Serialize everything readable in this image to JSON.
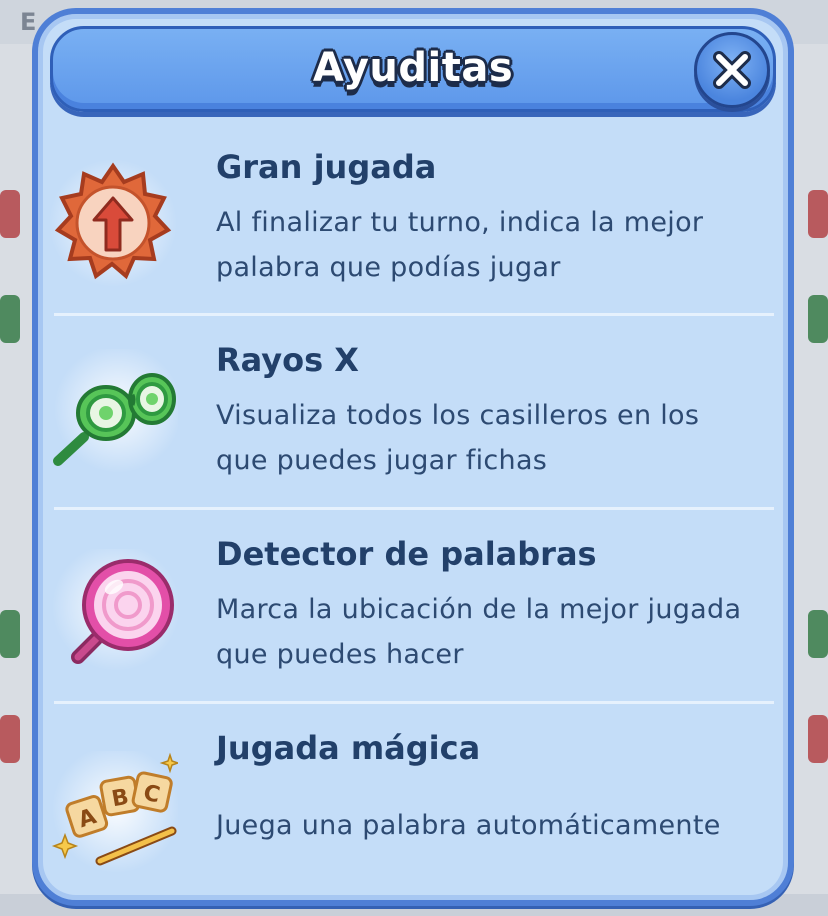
{
  "background": {
    "title_fragment": "E"
  },
  "dialog": {
    "title": "Ayuditas",
    "close_label": "close"
  },
  "helpers": [
    {
      "name": "Gran jugada",
      "description_line1": "Al finalizar tu turno, indica la mejor",
      "description_line2": "palabra que podías jugar",
      "icon": "arrow-badge-icon"
    },
    {
      "name": "Rayos X",
      "description_line1": "Visualiza todos los casilleros en los",
      "description_line2": "que puedes jugar fichas",
      "icon": "xray-glasses-icon"
    },
    {
      "name": "Detector de palabras",
      "description_line1": "Marca la ubicación de la mejor jugada",
      "description_line2": "que puedes hacer",
      "icon": "magnifier-icon"
    },
    {
      "name": "Jugada mágica",
      "description_line1": "Juega una palabra automáticamente",
      "icon": "magic-letters-icon"
    }
  ],
  "colors": {
    "panel": "#c4ddf8",
    "header": "#6aa3ef",
    "text": "#22406a",
    "border": "#4f7fd6"
  }
}
